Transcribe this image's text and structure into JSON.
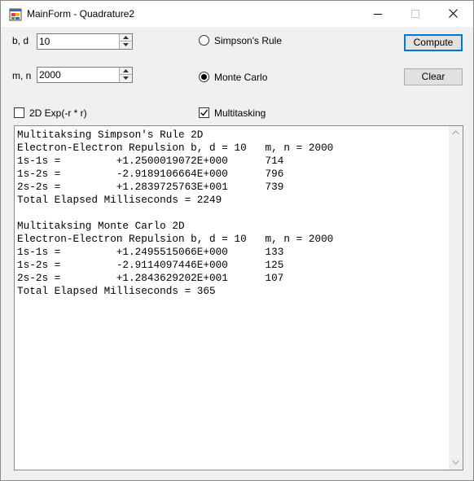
{
  "window": {
    "title": "MainForm - Quadrature2",
    "icons": {
      "app": "app-form-icon",
      "minimize": "minimize-icon",
      "maximize": "maximize-icon",
      "close": "close-icon"
    }
  },
  "controls": {
    "bd_label": "b, d",
    "bd_value": "10",
    "mn_label": "m, n",
    "mn_value": "2000",
    "simpsons_label": "Simpson's Rule",
    "simpsons_selected": false,
    "montecarlo_label": "Monte Carlo",
    "montecarlo_selected": true,
    "exp2d_label": "2D Exp(-r * r)",
    "exp2d_checked": false,
    "multitasking_label": "Multitasking",
    "multitasking_checked": true,
    "compute_label": "Compute",
    "clear_label": "Clear"
  },
  "output": {
    "lines": [
      "Multitaksing Simpson's Rule 2D",
      "Electron-Electron Repulsion b, d = 10   m, n = 2000",
      "1s-1s =         +1.2500019072E+000      714",
      "1s-2s =         -2.9189106664E+000      796",
      "2s-2s =         +1.2839725763E+001      739",
      "Total Elapsed Milliseconds = 2249",
      "",
      "Multitaksing Monte Carlo 2D",
      "Electron-Electron Repulsion b, d = 10   m, n = 2000",
      "1s-1s =         +1.2495515066E+000      133",
      "1s-2s =         -2.9114097446E+000      125",
      "2s-2s =         +1.2843629202E+001      107",
      "Total Elapsed Milliseconds = 365"
    ]
  },
  "colors": {
    "accent": "#0078d7",
    "window_bg": "#f0f0f0",
    "titlebar_bg": "#ffffff"
  }
}
